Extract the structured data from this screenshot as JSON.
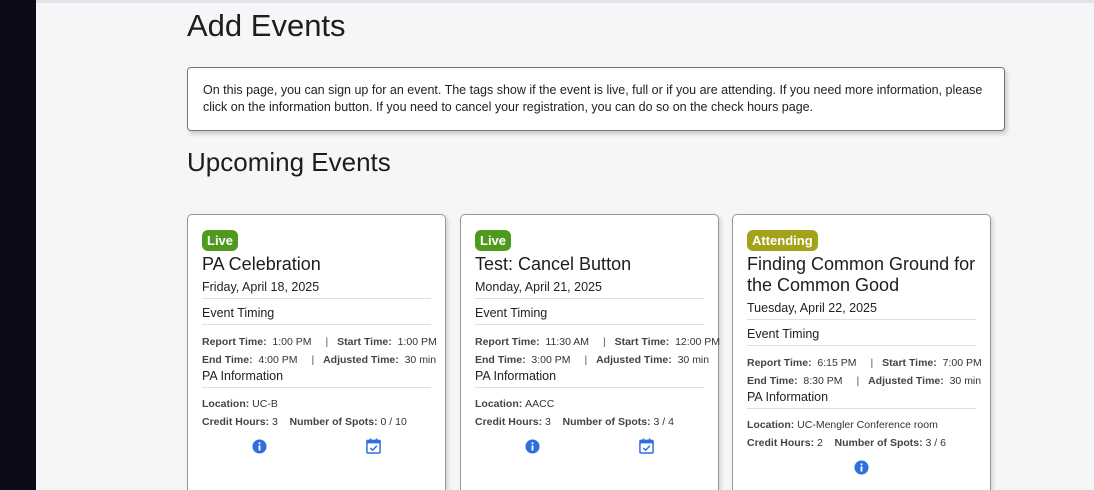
{
  "page": {
    "title": "Add Events",
    "intro": "On this page, you can sign up for an event. The tags show if the event is live, full or if you are attending. If you need more information, please click on the information button. If you need to cancel your registration, you can do so on the check hours page.",
    "section_title": "Upcoming Events"
  },
  "labels": {
    "event_timing": "Event Timing",
    "report_time": "Report Time:",
    "start_time": "Start Time:",
    "end_time": "End Time:",
    "adjusted_time": "Adjusted Time:",
    "pa_information": "PA Information",
    "location": "Location:",
    "credit_hours": "Credit Hours:",
    "number_of_spots": "Number of Spots:",
    "separator": "|"
  },
  "colors": {
    "live": "#4f9a1e",
    "attending": "#a3a21b",
    "icon_blue": "#2f6fdd"
  },
  "events": [
    {
      "status": "Live",
      "title": "PA Celebration",
      "date": "Friday, April 18, 2025",
      "report_time": "1:00 PM",
      "start_time": "1:00 PM",
      "end_time": "4:00 PM",
      "adjusted_time": "30 min",
      "location": "UC-B",
      "credit_hours": "3",
      "spots": "0 / 10",
      "icons": [
        "info-icon",
        "calendar-check-icon"
      ]
    },
    {
      "status": "Live",
      "title": "Test: Cancel Button",
      "date": "Monday, April 21, 2025",
      "report_time": "11:30 AM",
      "start_time": "12:00 PM",
      "end_time": "3:00 PM",
      "adjusted_time": "30 min",
      "location": "AACC",
      "credit_hours": "3",
      "spots": "3 / 4",
      "icons": [
        "info-icon",
        "calendar-check-icon"
      ]
    },
    {
      "status": "Attending",
      "title": "Finding Common Ground for the Common Good",
      "date": "Tuesday, April 22, 2025",
      "report_time": "6:15 PM",
      "start_time": "7:00 PM",
      "end_time": "8:30 PM",
      "adjusted_time": "30 min",
      "location": "UC-Mengler Conference room",
      "credit_hours": "2",
      "spots": "3 / 6",
      "icons": [
        "info-icon"
      ]
    }
  ]
}
